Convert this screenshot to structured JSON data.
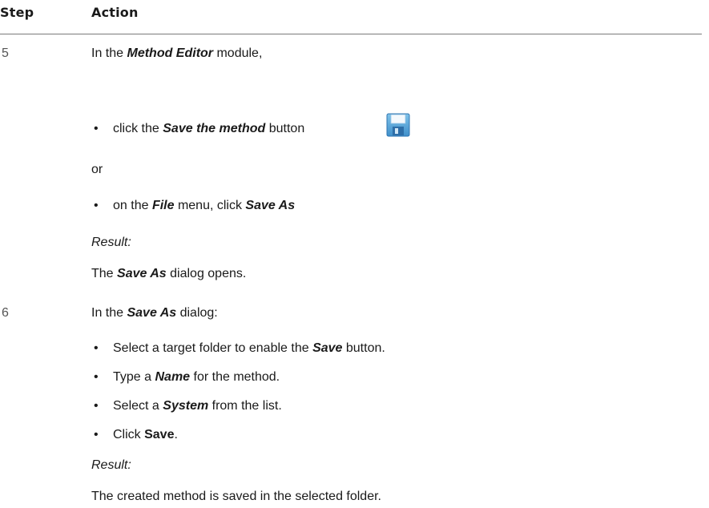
{
  "table": {
    "header": {
      "step": "Step",
      "action": "Action"
    },
    "steps": [
      {
        "number": "5",
        "intro": {
          "pre": "In the ",
          "emph": "Method Editor",
          "post": " module,"
        },
        "bullet1": {
          "pre": "click the ",
          "emph": "Save the method",
          "post": " button"
        },
        "or": "or",
        "bullet2": {
          "pre": "on the ",
          "emph1": "File",
          "mid": " menu, click ",
          "emph2": "Save As"
        },
        "result_label": "Result:",
        "result": {
          "pre": "The ",
          "emph": "Save As",
          "post": " dialog opens."
        }
      },
      {
        "number": "6",
        "intro": {
          "pre": "In the ",
          "emph": "Save As",
          "post": " dialog:"
        },
        "bullets": [
          {
            "pre": "Select a target folder to enable the ",
            "emph": "Save",
            "post": " button."
          },
          {
            "pre": "Type a ",
            "emph": "Name",
            "post": " for the method."
          },
          {
            "pre": "Select a ",
            "emph": "System",
            "post": " from the list."
          },
          {
            "pre": "Click ",
            "emph": "Save",
            "post": "."
          }
        ],
        "result_label": "Result:",
        "result": "The created method is saved in the selected folder."
      }
    ]
  },
  "icons": {
    "save_button_icon": "floppy-disk-save-icon",
    "bullet": "•"
  }
}
